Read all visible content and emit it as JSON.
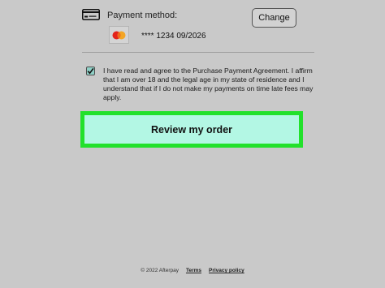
{
  "payment": {
    "label": "Payment method:",
    "change_label": "Change",
    "card_brand_icon": "mastercard-logo",
    "card_number": "**** 1234  09/2026"
  },
  "agreement": {
    "checked": true,
    "text": "I have read and agree to the Purchase Payment Agreement. I affirm that I am over 18 and the legal age in my state of residence and I understand that if I do not make my payments on time late fees may apply."
  },
  "review": {
    "label": "Review my order",
    "highlight_color": "#22e12b",
    "button_color": "#b3f7e4"
  },
  "footer": {
    "copyright": "© 2022 Afterpay",
    "terms": "Terms",
    "privacy": "Privacy policy"
  }
}
